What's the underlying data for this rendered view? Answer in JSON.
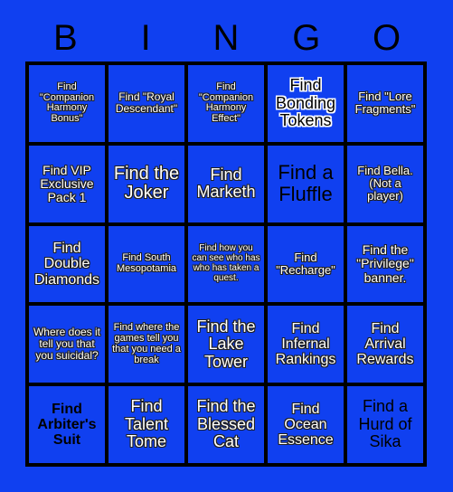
{
  "card": {
    "background_color": "#1040f0",
    "border_color": "#000000",
    "header_letters": [
      "B",
      "I",
      "N",
      "G",
      "O"
    ],
    "columns": 5,
    "rows": 5
  },
  "cells": [
    {
      "row": 1,
      "col": 1,
      "text": "Find \"Companion Harmony Bonus\"",
      "style": "outline-white",
      "size": "fs-11"
    },
    {
      "row": 1,
      "col": 2,
      "text": "Find \"Royal Descendant\"",
      "style": "outline-white",
      "size": "fs-12"
    },
    {
      "row": 1,
      "col": 3,
      "text": "Find \"Companion Harmony Effect\"",
      "style": "outline-white",
      "size": "fs-11"
    },
    {
      "row": 1,
      "col": 4,
      "text": "Find Bonding Tokens",
      "style": "outline-black",
      "size": "fs-18"
    },
    {
      "row": 1,
      "col": 5,
      "text": "Find \"Lore Fragments\"",
      "style": "outline-white",
      "size": "fs-13"
    },
    {
      "row": 2,
      "col": 1,
      "text": "Find VIP Exclusive Pack 1",
      "style": "outline-white",
      "size": "fs-14"
    },
    {
      "row": 2,
      "col": 2,
      "text": "Find the Joker",
      "style": "outline-white",
      "size": "fs-20"
    },
    {
      "row": 2,
      "col": 3,
      "text": "Find Marketh",
      "style": "outline-white",
      "size": "fs-18"
    },
    {
      "row": 2,
      "col": 4,
      "text": "Find a Fluffle",
      "style": "plain-black",
      "size": "fs-22"
    },
    {
      "row": 2,
      "col": 5,
      "text": "Find Bella. (Not a player)",
      "style": "outline-white",
      "size": "fs-13"
    },
    {
      "row": 3,
      "col": 1,
      "text": "Find Double Diamonds",
      "style": "outline-white",
      "size": "fs-16"
    },
    {
      "row": 3,
      "col": 2,
      "text": "Find South Mesopotamia",
      "style": "outline-white",
      "size": "fs-11"
    },
    {
      "row": 3,
      "col": 3,
      "text": "Find how you can see who has who has taken a quest.",
      "style": "outline-white",
      "size": "fs-10"
    },
    {
      "row": 3,
      "col": 4,
      "text": "Find \"Recharge\"",
      "style": "outline-white",
      "size": "fs-13"
    },
    {
      "row": 3,
      "col": 5,
      "text": "Find the \"Privilege\" banner.",
      "style": "outline-white",
      "size": "fs-14"
    },
    {
      "row": 4,
      "col": 1,
      "text": "Where does it tell you that you suicidal?",
      "style": "outline-white",
      "size": "fs-12"
    },
    {
      "row": 4,
      "col": 2,
      "text": "Find where the games tell you that you need a break",
      "style": "outline-white",
      "size": "fs-11"
    },
    {
      "row": 4,
      "col": 3,
      "text": "Find the Lake Tower",
      "style": "outline-white",
      "size": "fs-18"
    },
    {
      "row": 4,
      "col": 4,
      "text": "Find Infernal Rankings",
      "style": "outline-white",
      "size": "fs-16"
    },
    {
      "row": 4,
      "col": 5,
      "text": "Find Arrival Rewards",
      "style": "outline-white",
      "size": "fs-16"
    },
    {
      "row": 5,
      "col": 1,
      "text": "Find Arbiter's Suit",
      "style": "bold-black",
      "size": "fs-16"
    },
    {
      "row": 5,
      "col": 2,
      "text": "Find Talent Tome",
      "style": "outline-white",
      "size": "fs-18"
    },
    {
      "row": 5,
      "col": 3,
      "text": "Find the Blessed Cat",
      "style": "outline-white",
      "size": "fs-18"
    },
    {
      "row": 5,
      "col": 4,
      "text": "Find Ocean Essence",
      "style": "outline-white",
      "size": "fs-17"
    },
    {
      "row": 5,
      "col": 5,
      "text": "Find a Hurd of Sika",
      "style": "plain-black",
      "size": "fs-18"
    }
  ]
}
